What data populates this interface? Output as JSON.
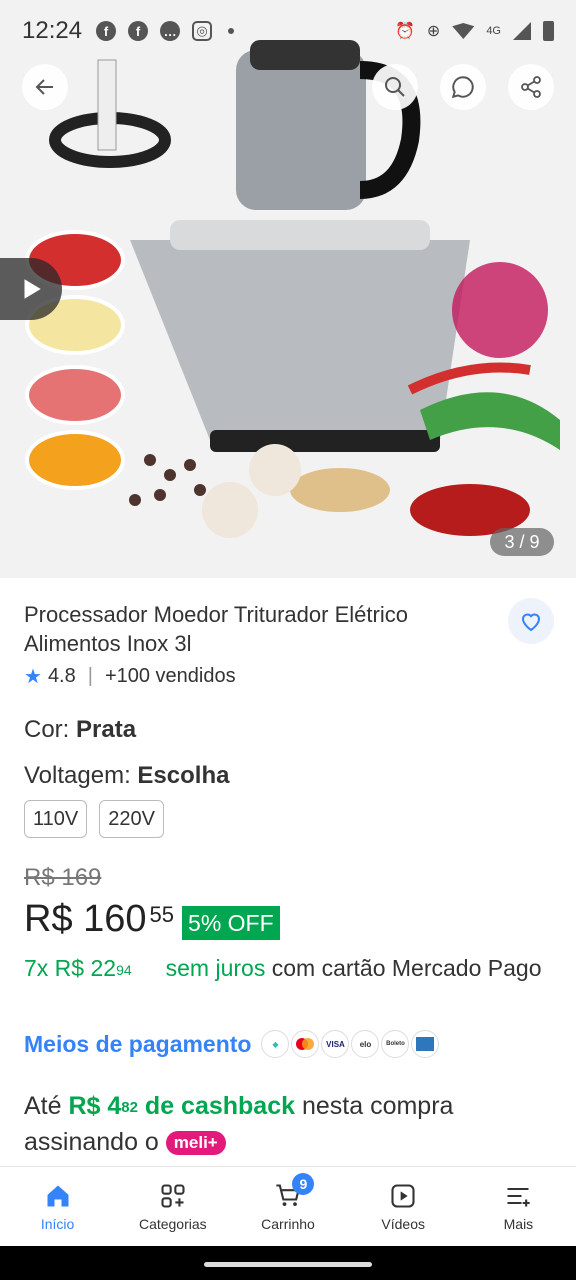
{
  "status_bar": {
    "time": "12:24",
    "network": "4G"
  },
  "gallery": {
    "counter": "3 / 9"
  },
  "product": {
    "title": "Processador Moedor Triturador Elétrico Alimentos Inox 3l",
    "rating": "4.8",
    "sold": "+100 vendidos"
  },
  "color": {
    "label": "Cor: ",
    "value": "Prata"
  },
  "voltage": {
    "label": "Voltagem: ",
    "value": "Escolha",
    "options": [
      "110V",
      "220V"
    ]
  },
  "price": {
    "old": "R$ 169",
    "main": "R$ 160",
    "cents": "55",
    "discount": "5% OFF"
  },
  "installments": {
    "count": "7x R$ 22",
    "cents": "94",
    "no_interest": "sem juros",
    "rest": "com cartão Mercado Pago"
  },
  "payment": {
    "link": "Meios de pagamento",
    "logos": [
      "pix",
      "mastercard",
      "VISA",
      "elo",
      "Boleto",
      "amex"
    ]
  },
  "cashback": {
    "prefix": "Até ",
    "amount": "R$ 4",
    "amount_cents": "82",
    "label": " de cashback",
    "suffix": " nesta compra assinando o ",
    "badge": "meli+"
  },
  "nav": {
    "items": [
      "Início",
      "Categorias",
      "Carrinho",
      "Vídeos",
      "Mais"
    ],
    "cart_count": "9"
  },
  "colors": {
    "accent": "#3483fa",
    "green": "#00a650",
    "meli": "#e31a7c"
  }
}
